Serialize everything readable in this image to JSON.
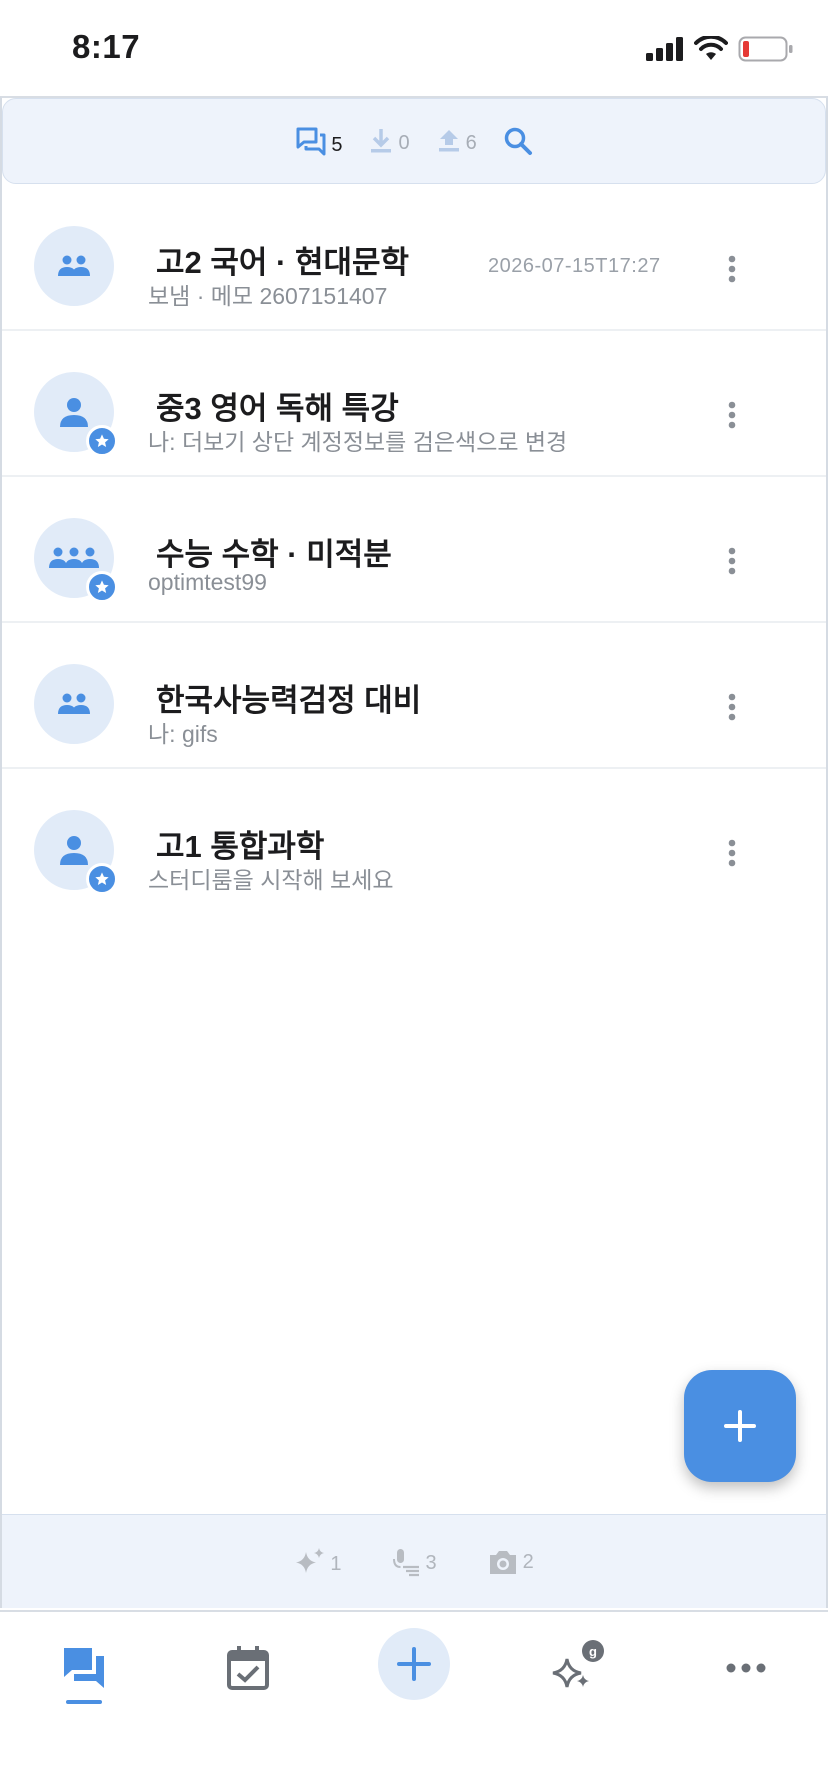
{
  "status_bar": {
    "time": "8:17"
  },
  "top_bar": {
    "chats_count": "5",
    "downloads_count": "0",
    "uploads_count": "6"
  },
  "rooms": [
    {
      "title": "고2 국어 · 현대문학",
      "subtitle": "보냄 · 메모 2607151407",
      "time": "2026-07-15T17:27",
      "avatar_icon": "group-icon",
      "favorite": false
    },
    {
      "title": "중3 영어 독해 특강",
      "subtitle": "나: 더보기 상단 계정정보를 검은색으로 변경",
      "time": "",
      "avatar_icon": "person-icon",
      "favorite": true
    },
    {
      "title": "수능 수학 · 미적분",
      "subtitle": "optimtest99",
      "time": "",
      "avatar_icon": "large-group-icon",
      "favorite": true
    },
    {
      "title": "한국사능력검정 대비",
      "subtitle": "나: gifs",
      "time": "",
      "avatar_icon": "group-icon",
      "favorite": false
    },
    {
      "title": "고1 통합과학",
      "subtitle": "스터디룸을 시작해 보세요",
      "time": "",
      "avatar_icon": "person-icon",
      "favorite": true
    }
  ],
  "bottom_bar": {
    "ai_count": "1",
    "voice_count": "3",
    "photo_count": "2"
  },
  "tab_bar": {
    "ai_badge": "g"
  },
  "colors": {
    "accent": "#4a8fe2",
    "accent_light": "#e1ebf8",
    "bar_bg": "#eef3fb",
    "muted": "#a7adb6"
  }
}
